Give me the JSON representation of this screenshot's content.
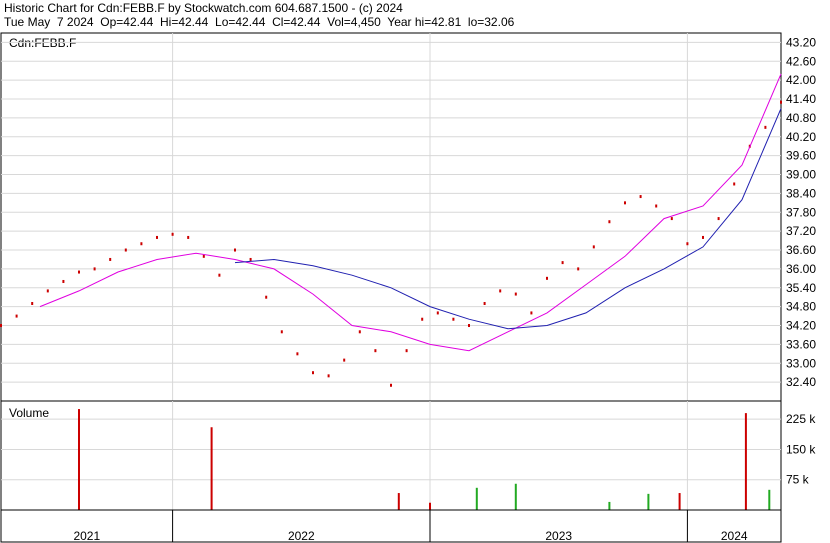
{
  "header": {
    "line1": "Historic Chart for Cdn:FEBB.F by Stockwatch.com 604.687.1500 - (c) 2024",
    "line2": "Tue May  7 2024  Op=42.44  Hi=42.44  Lo=42.44  Cl=42.44  Vol=4,450  Year hi=42.81  lo=32.06"
  },
  "chart_data": [
    {
      "type": "line",
      "title": "",
      "symbol_label": "Cdn:FEBB.F",
      "ylim": [
        31.8,
        43.5
      ],
      "y_ticks": [
        "43.20",
        "42.60",
        "42.00",
        "41.40",
        "40.80",
        "40.20",
        "39.60",
        "39.00",
        "38.40",
        "37.80",
        "37.20",
        "36.60",
        "36.00",
        "35.40",
        "34.80",
        "34.20",
        "33.60",
        "33.00",
        "32.40"
      ],
      "x_ticks": [
        "2021",
        "2022",
        "2023",
        "2024"
      ],
      "grid": true,
      "price_color": "#cc0000",
      "series": [
        {
          "kind": "price",
          "color": "#cc0000",
          "x": [
            0,
            0.02,
            0.04,
            0.06,
            0.08,
            0.1,
            0.12,
            0.14,
            0.16,
            0.18,
            0.2,
            0.22,
            0.24,
            0.26,
            0.28,
            0.3,
            0.32,
            0.34,
            0.36,
            0.38,
            0.4,
            0.42,
            0.44,
            0.46,
            0.48,
            0.5,
            0.52,
            0.54,
            0.56,
            0.58,
            0.6,
            0.62,
            0.64,
            0.66,
            0.68,
            0.7,
            0.72,
            0.74,
            0.76,
            0.78,
            0.8,
            0.82,
            0.84,
            0.86,
            0.88,
            0.9,
            0.92,
            0.94,
            0.96,
            0.98,
            1.0
          ],
          "y": [
            34.2,
            34.5,
            34.9,
            35.3,
            35.6,
            35.9,
            36.0,
            36.3,
            36.6,
            36.8,
            37.0,
            37.1,
            37.0,
            36.4,
            35.8,
            36.6,
            36.3,
            35.1,
            34.0,
            33.3,
            32.7,
            32.6,
            33.1,
            34.0,
            33.4,
            32.3,
            33.4,
            34.4,
            34.6,
            34.4,
            34.2,
            34.9,
            35.3,
            35.2,
            34.6,
            35.7,
            36.2,
            36.0,
            36.7,
            37.5,
            38.1,
            38.3,
            38.0,
            37.6,
            36.8,
            37.0,
            37.6,
            38.7,
            39.9,
            40.5,
            41.3
          ]
        },
        {
          "kind": "ma_short",
          "color": "#e000e0",
          "x": [
            0.05,
            0.1,
            0.15,
            0.2,
            0.25,
            0.3,
            0.35,
            0.4,
            0.45,
            0.5,
            0.55,
            0.6,
            0.65,
            0.7,
            0.75,
            0.8,
            0.85,
            0.9,
            0.95,
            1.0
          ],
          "y": [
            34.8,
            35.3,
            35.9,
            36.3,
            36.5,
            36.3,
            36.0,
            35.2,
            34.2,
            34.0,
            33.6,
            33.4,
            34.0,
            34.6,
            35.5,
            36.4,
            37.6,
            38.0,
            39.3,
            42.2
          ]
        },
        {
          "kind": "ma_long",
          "color": "#2020b0",
          "x": [
            0.3,
            0.35,
            0.4,
            0.45,
            0.5,
            0.55,
            0.6,
            0.65,
            0.7,
            0.75,
            0.8,
            0.85,
            0.9,
            0.95,
            1.0
          ],
          "y": [
            36.2,
            36.3,
            36.1,
            35.8,
            35.4,
            34.8,
            34.4,
            34.1,
            34.2,
            34.6,
            35.4,
            36.0,
            36.7,
            38.2,
            41.1
          ]
        }
      ]
    },
    {
      "type": "bar",
      "title": "Volume",
      "ylim": [
        0,
        270000
      ],
      "y_ticks": [
        "225 k",
        "150 k",
        "75 k"
      ],
      "spikes": [
        {
          "x": 0.1,
          "value": 250000,
          "color": "#cc0000"
        },
        {
          "x": 0.27,
          "value": 205000,
          "color": "#cc0000"
        },
        {
          "x": 0.51,
          "value": 42000,
          "color": "#cc0000"
        },
        {
          "x": 0.55,
          "value": 18000,
          "color": "#cc0000"
        },
        {
          "x": 0.61,
          "value": 55000,
          "color": "#22aa22"
        },
        {
          "x": 0.66,
          "value": 65000,
          "color": "#22aa22"
        },
        {
          "x": 0.78,
          "value": 20000,
          "color": "#22aa22"
        },
        {
          "x": 0.83,
          "value": 40000,
          "color": "#22aa22"
        },
        {
          "x": 0.87,
          "value": 42000,
          "color": "#cc0000"
        },
        {
          "x": 0.955,
          "value": 240000,
          "color": "#cc0000"
        },
        {
          "x": 0.985,
          "value": 50000,
          "color": "#22aa22"
        }
      ]
    }
  ]
}
